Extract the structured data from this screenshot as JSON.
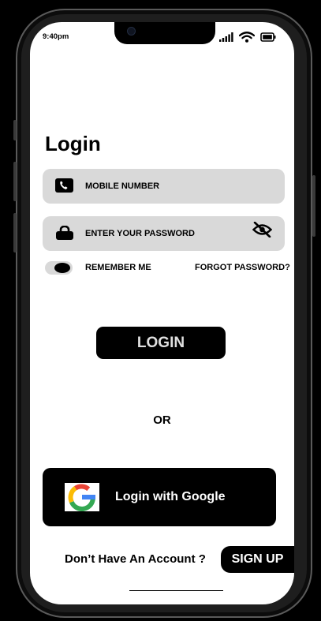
{
  "status_bar": {
    "time": "9:40pm"
  },
  "page": {
    "title": "Login"
  },
  "mobile_field": {
    "label": "MOBILE NUMBER",
    "icon": "phone-icon"
  },
  "password_field": {
    "label": "ENTER YOUR PASSWORD",
    "icon": "lock-icon",
    "toggle_icon": "eye-slash-icon"
  },
  "remember_me": {
    "label": "REMEMBER ME",
    "checked": true
  },
  "forgot_password": {
    "label": "FORGOT PASSWORD?"
  },
  "login_button": {
    "label": "LOGIN"
  },
  "divider": {
    "label": "OR"
  },
  "google_button": {
    "label": "Login with Google",
    "icon": "google-logo"
  },
  "signup_prompt": {
    "text": "Don’t Have An Account ?",
    "button_label": "SIGN UP"
  },
  "colors": {
    "field_bg": "#d9d9d9",
    "button_bg": "#000000",
    "screen_bg": "#ffffff"
  }
}
